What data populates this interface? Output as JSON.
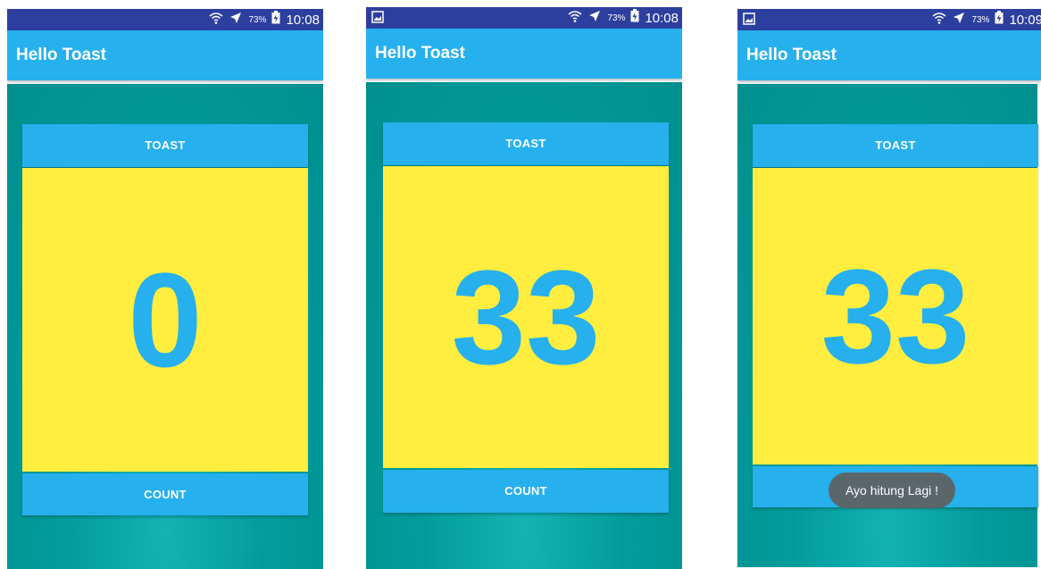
{
  "app": {
    "title": "Hello Toast"
  },
  "status_bar": {
    "battery_percent": "73%"
  },
  "buttons": {
    "toast_label": "TOAST",
    "count_label": "COUNT"
  },
  "screens": [
    {
      "time": "10:08",
      "count": "0"
    },
    {
      "time": "10:08",
      "count": "33"
    },
    {
      "time": "10:09",
      "count": "33",
      "toast_message": "Ayo hitung Lagi !"
    }
  ],
  "colors": {
    "status_bar": "#2d3f9e",
    "app_bar": "#26b0ee",
    "background_teal": "#009999",
    "count_yellow": "#ffee40",
    "toast_bg": "#5f5f5f"
  },
  "icons": [
    "wifi-icon",
    "airplane-mode-icon",
    "battery-icon",
    "screenshot-notification-icon"
  ]
}
